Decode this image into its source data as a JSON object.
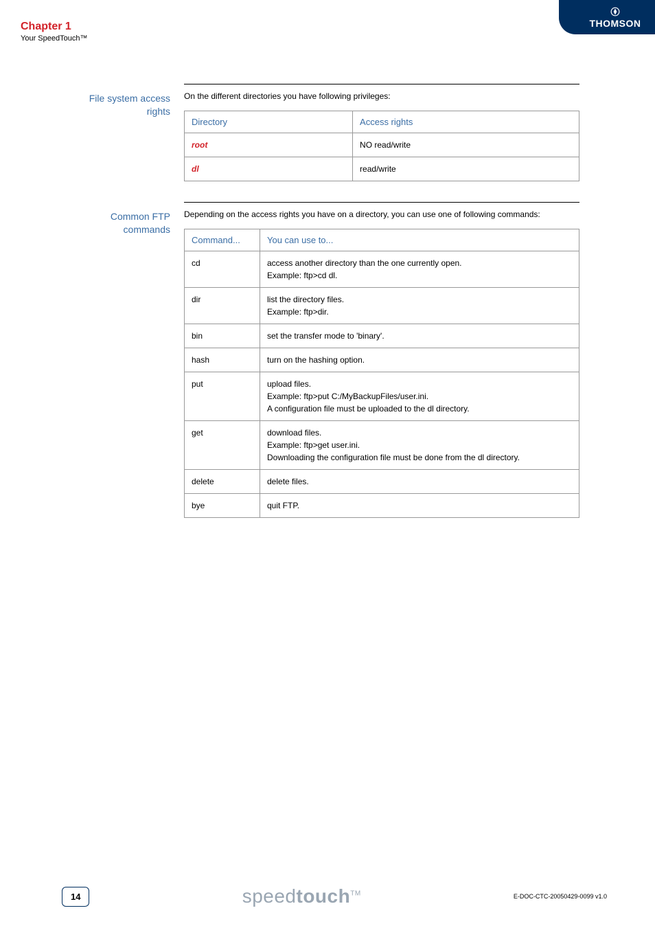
{
  "header": {
    "chapter": "Chapter 1",
    "subtitle": "Your SpeedTouch™",
    "brand": "THOMSON"
  },
  "sections": {
    "file_access": {
      "label_line1": "File system access",
      "label_line2": "rights",
      "intro": "On the different directories you have following privileges:",
      "table_head_dir": "Directory",
      "table_head_rights": "Access rights",
      "rows": [
        {
          "dir": "root",
          "rights": "NO read/write",
          "dir_class": "root-cell"
        },
        {
          "dir": "dl",
          "rights": "read/write",
          "dir_class": "dl-cell"
        }
      ]
    },
    "ftp": {
      "label_line1": "Common FTP",
      "label_line2": "commands",
      "intro": "Depending on the access rights you have on a directory, you can use one of following commands:",
      "table_head_cmd": "Command...",
      "table_head_use": "You can use to...",
      "rows": [
        {
          "cmd": "cd",
          "use": "access another directory than the one currently open.\nExample: ftp>cd dl."
        },
        {
          "cmd": "dir",
          "use": "list the directory files.\nExample: ftp>dir."
        },
        {
          "cmd": "bin",
          "use": "set the transfer mode to 'binary'."
        },
        {
          "cmd": "hash",
          "use": "turn on the hashing option."
        },
        {
          "cmd": "put",
          "use": "upload files.\nExample: ftp>put C:/MyBackupFiles/user.ini.\nA configuration file must be uploaded to the dl directory."
        },
        {
          "cmd": "get",
          "use": "download files.\nExample: ftp>get user.ini.\nDownloading the configuration file must be done from the dl directory."
        },
        {
          "cmd": "delete",
          "use": "delete files."
        },
        {
          "cmd": "bye",
          "use": "quit FTP."
        }
      ]
    }
  },
  "footer": {
    "page": "14",
    "logo_light": "speed",
    "logo_bold": "touch",
    "logo_tm": "TM",
    "doc": "E-DOC-CTC-20050429-0099 v1.0"
  }
}
